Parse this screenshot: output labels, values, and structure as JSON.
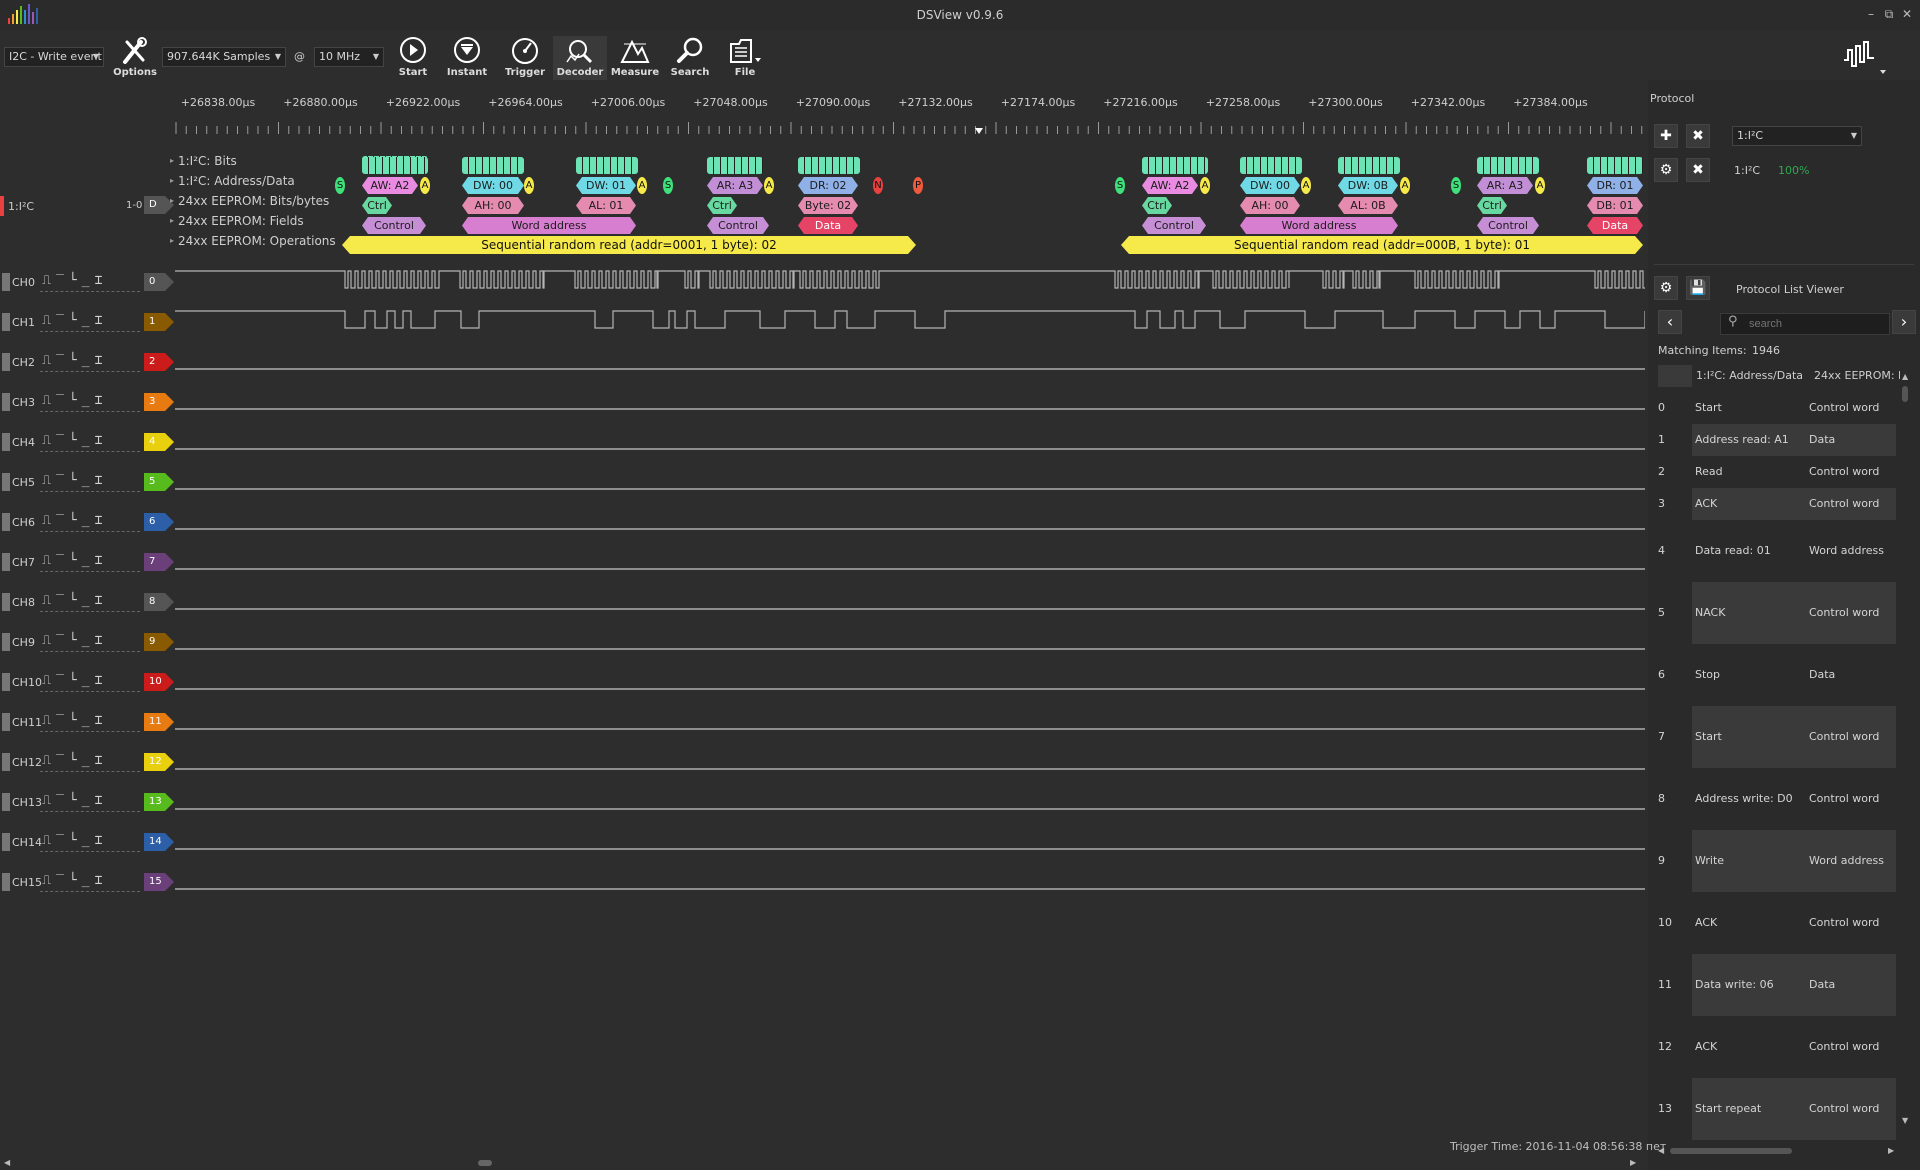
{
  "window": {
    "title": "DSView v0.9.6",
    "controls": [
      "–",
      "⧉",
      "✕"
    ]
  },
  "toolbar": {
    "trigger_select": "I2C - Write event",
    "samples_select": "907.644K Samples",
    "at_sign": "@",
    "rate_select": "10 MHz",
    "options_label": "Options",
    "start_label": "Start",
    "instant_label": "Instant",
    "trigger_label": "Trigger",
    "decoder_label": "Decoder",
    "measure_label": "Measure",
    "search_label": "Search",
    "file_label": "File"
  },
  "ruler": {
    "ticks": [
      "+26838.00µs",
      "+26880.00µs",
      "+26922.00µs",
      "+26964.00µs",
      "+27006.00µs",
      "+27048.00µs",
      "+27090.00µs",
      "+27132.00µs",
      "+27174.00µs",
      "+27216.00µs",
      "+27258.00µs",
      "+27300.00µs",
      "+27342.00µs",
      "+27384.00µs"
    ]
  },
  "decoder": {
    "name": "1:I²C",
    "range": "1-0",
    "tag": "D",
    "rows": [
      "1:I²C: Bits",
      "1:I²C: Address/Data",
      "24xx EEPROM: Bits/bytes",
      "24xx EEPROM: Fields",
      "24xx EEPROM: Operations"
    ],
    "colors": {
      "bits": "#6be3b4",
      "addr_write": "#e98be1",
      "data_write": "#6fd9e6",
      "addr_read": "#c28fd6",
      "data_read": "#8fb1e8",
      "ack": "#f6e94a",
      "start": "#3ee07a",
      "ctrl": "#67d8a0",
      "data_byte": "#e58bb0",
      "field_control": "#c68fd5",
      "field_word": "#d87ed0",
      "field_data": "#e64466",
      "operation": "#f6e94a",
      "nack": "#e94040"
    },
    "group1": {
      "aw": "AW: A2",
      "dw1": "DW: 00",
      "dw2": "DW: 01",
      "ar": "AR: A3",
      "dr": "DR: 02",
      "ctrl1": "Ctrl",
      "ah": "AH: 00",
      "al": "AL: 01",
      "ctrl2": "Ctrl",
      "byte": "Byte: 02",
      "f_control1": "Control",
      "f_word": "Word address",
      "f_control2": "Control",
      "f_data": "Data",
      "operation": "Sequential random read (addr=0001, 1 byte): 02"
    },
    "group2": {
      "aw": "AW: A2",
      "dw1": "DW: 00",
      "dw2": "DW: 0B",
      "ar": "AR: A3",
      "dr": "DR: 01",
      "ctrl1": "Ctrl",
      "ah": "AH: 00",
      "al": "AL: 0B",
      "ctrl2": "Ctrl",
      "byte": "DB: 01",
      "f_control1": "Control",
      "f_word": "Word address",
      "f_control2": "Control",
      "f_data": "Data",
      "operation": "Sequential random read (addr=000B, 1 byte): 01"
    },
    "markers": {
      "s": "S",
      "a": "A",
      "n": "N",
      "p": "P"
    }
  },
  "channels": [
    {
      "name": "CH0",
      "num": "0",
      "color": "#555555"
    },
    {
      "name": "CH1",
      "num": "1",
      "color": "#8a5a00"
    },
    {
      "name": "CH2",
      "num": "2",
      "color": "#cc1b1b"
    },
    {
      "name": "CH3",
      "num": "3",
      "color": "#e87a12"
    },
    {
      "name": "CH4",
      "num": "4",
      "color": "#e8d00e"
    },
    {
      "name": "CH5",
      "num": "5",
      "color": "#57bb1d"
    },
    {
      "name": "CH6",
      "num": "6",
      "color": "#2c5fa8"
    },
    {
      "name": "CH7",
      "num": "7",
      "color": "#6a3f7a"
    },
    {
      "name": "CH8",
      "num": "8",
      "color": "#555555"
    },
    {
      "name": "CH9",
      "num": "9",
      "color": "#8a5a00"
    },
    {
      "name": "CH10",
      "num": "10",
      "color": "#cc1b1b"
    },
    {
      "name": "CH11",
      "num": "11",
      "color": "#e87a12"
    },
    {
      "name": "CH12",
      "num": "12",
      "color": "#e8d00e"
    },
    {
      "name": "CH13",
      "num": "13",
      "color": "#57bb1d"
    },
    {
      "name": "CH14",
      "num": "14",
      "color": "#2c5fa8"
    },
    {
      "name": "CH15",
      "num": "15",
      "color": "#6a3f7a"
    }
  ],
  "trigger_icons": "⎍‾└_⌶",
  "protocol_panel": {
    "title": "Protocol",
    "decoder_select": "1:I²C",
    "decoder_name": "1:I²C",
    "progress": "100%",
    "list_viewer_title": "Protocol List Viewer",
    "search_placeholder": "search",
    "matching_label": "Matching Items:",
    "matching_count": "1946",
    "col1": "1:I²C: Address/Data",
    "col2": "24xx EEPROM: I",
    "rows": [
      {
        "idx": "0",
        "c1": "Start",
        "c2": "Control word"
      },
      {
        "idx": "1",
        "c1": "Address read: A1",
        "c2": "Data"
      },
      {
        "idx": "2",
        "c1": "Read",
        "c2": "Control word"
      },
      {
        "idx": "3",
        "c1": "ACK",
        "c2": "Control word"
      },
      {
        "idx": "4",
        "c1": "Data read: 01",
        "c2": "Word address"
      },
      {
        "idx": "5",
        "c1": "NACK",
        "c2": "Control word"
      },
      {
        "idx": "6",
        "c1": "Stop",
        "c2": "Data"
      },
      {
        "idx": "7",
        "c1": "Start",
        "c2": "Control word"
      },
      {
        "idx": "8",
        "c1": "Address write: D0",
        "c2": "Control word"
      },
      {
        "idx": "9",
        "c1": "Write",
        "c2": "Word address"
      },
      {
        "idx": "10",
        "c1": "ACK",
        "c2": "Control word"
      },
      {
        "idx": "11",
        "c1": "Data write: 06",
        "c2": "Data"
      },
      {
        "idx": "12",
        "c1": "ACK",
        "c2": "Control word"
      },
      {
        "idx": "13",
        "c1": "Start repeat",
        "c2": "Control word"
      }
    ]
  },
  "status": {
    "trigger_time": "Trigger Time: 2016-11-04 08:56:38 пет"
  }
}
